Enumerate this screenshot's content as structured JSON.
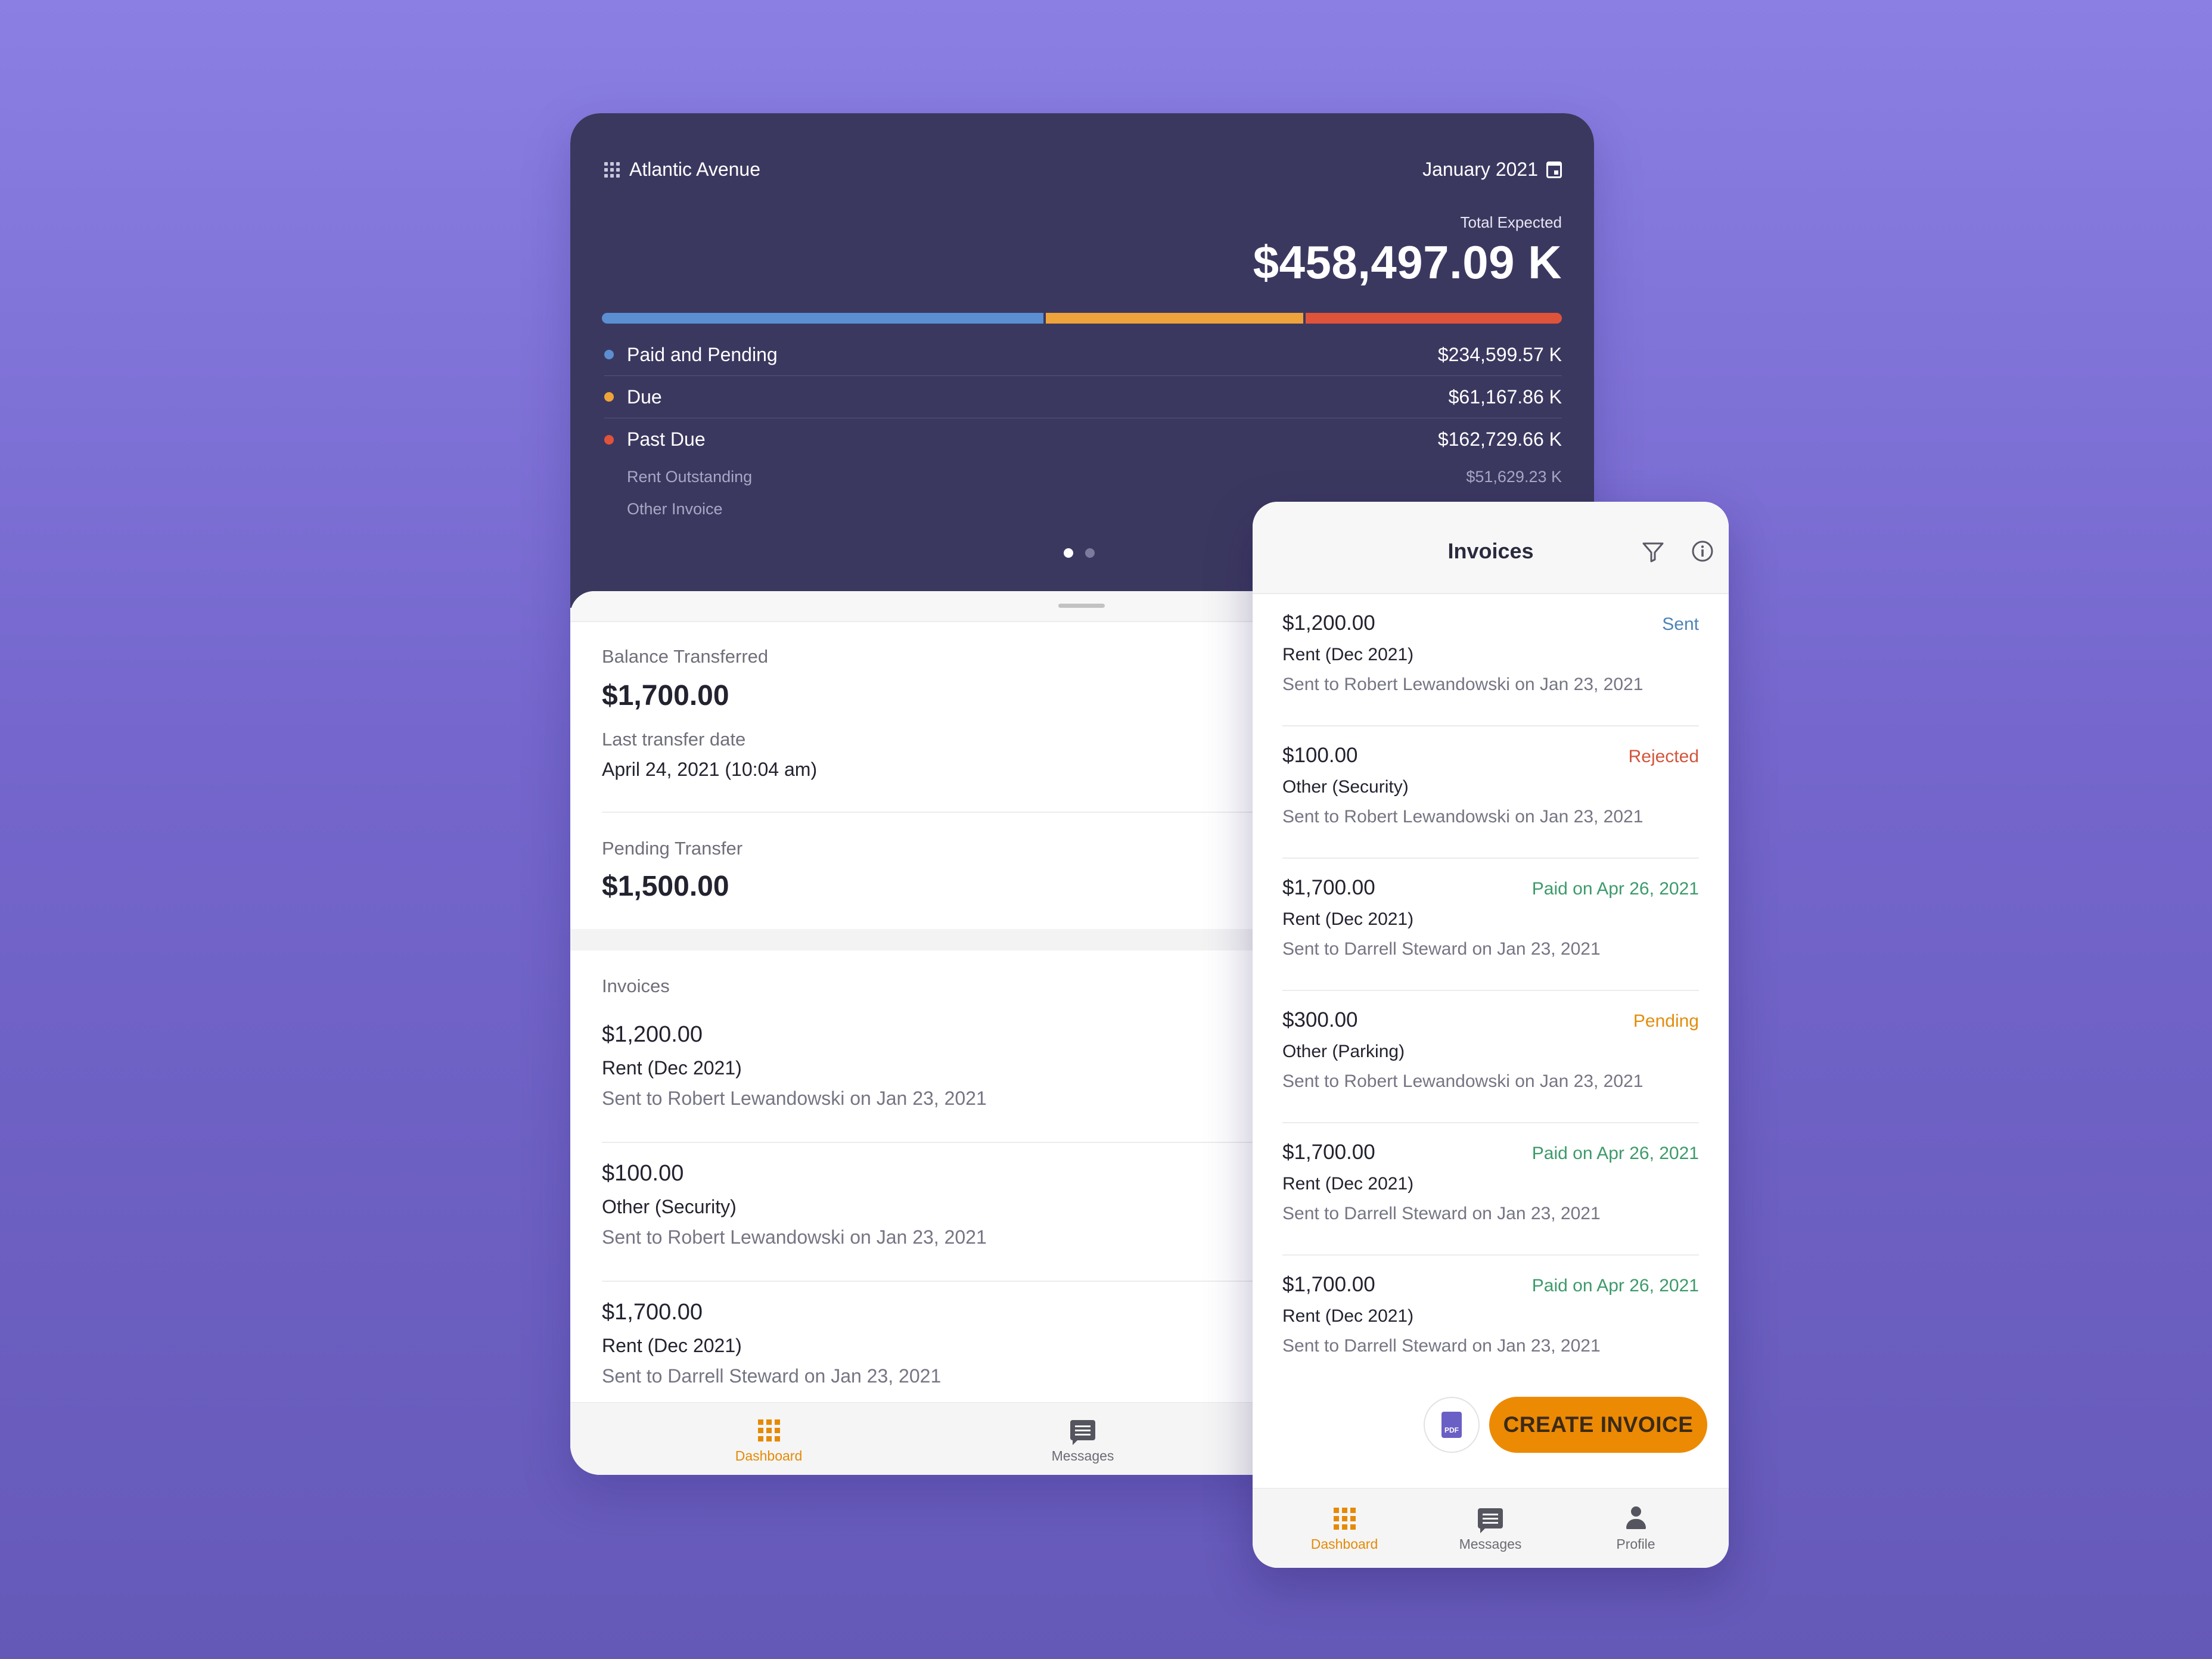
{
  "tablet": {
    "property": "Atlantic Avenue",
    "month": "January 2021",
    "total_label": "Total Expected",
    "total_value": "$458,497.09 K",
    "progress": [
      {
        "key": "paid",
        "fraction": 0.462,
        "color": "#5b8fd1"
      },
      {
        "key": "due",
        "fraction": 0.27,
        "color": "#eea43a"
      },
      {
        "key": "pastdue",
        "fraction": 0.268,
        "color": "#e0533b"
      }
    ],
    "summary": [
      {
        "label": "Paid and Pending",
        "value": "$234,599.57 K",
        "color": "#5b8fd1"
      },
      {
        "label": "Due",
        "value": "$61,167.86 K",
        "color": "#eea43a"
      },
      {
        "label": "Past Due",
        "value": "$162,729.66 K",
        "color": "#e0533b"
      }
    ],
    "sub_rows": [
      {
        "label": "Rent Outstanding",
        "value": "$51,629.23 K"
      },
      {
        "label": "Other Invoice",
        "value": ""
      }
    ],
    "balance_label": "Balance Transferred",
    "balance_value": "$1,700.00",
    "last_transfer_label": "Last transfer date",
    "last_transfer_value": "April 24, 2021 (10:04 am)",
    "pending_label": "Pending Transfer",
    "pending_value": "$1,500.00",
    "invoices_label": "Invoices",
    "invoices": [
      {
        "amount": "$1,200.00",
        "desc": "Rent (Dec 2021)",
        "sent": "Sent to Robert Lewandowski on Jan 23, 2021"
      },
      {
        "amount": "$100.00",
        "desc": "Other (Security)",
        "sent": "Sent to Robert Lewandowski on Jan 23, 2021"
      },
      {
        "amount": "$1,700.00",
        "desc": "Rent (Dec 2021)",
        "sent": "Sent to Darrell Steward on Jan 23, 2021"
      }
    ],
    "nav": {
      "dashboard": "Dashboard",
      "messages": "Messages"
    }
  },
  "phone": {
    "title": "Invoices",
    "invoices": [
      {
        "amount": "$1,200.00",
        "desc": "Rent (Dec 2021)",
        "sent": "Sent to Robert Lewandowski on Jan 23, 2021",
        "status": "Sent",
        "status_color": "#4f84b8"
      },
      {
        "amount": "$100.00",
        "desc": "Other (Security)",
        "sent": "Sent to Robert Lewandowski on Jan 23, 2021",
        "status": "Rejected",
        "status_color": "#d2563c"
      },
      {
        "amount": "$1,700.00",
        "desc": "Rent (Dec 2021)",
        "sent": "Sent to Darrell Steward on Jan 23, 2021",
        "status": "Paid on Apr 26, 2021",
        "status_color": "#3d9a6b"
      },
      {
        "amount": "$300.00",
        "desc": "Other (Parking)",
        "sent": "Sent to Robert Lewandowski on Jan 23, 2021",
        "status": "Pending",
        "status_color": "#e38d0d"
      },
      {
        "amount": "$1,700.00",
        "desc": "Rent (Dec 2021)",
        "sent": "Sent to Darrell Steward on Jan 23, 2021",
        "status": "Paid on Apr 26, 2021",
        "status_color": "#3d9a6b"
      },
      {
        "amount": "$1,700.00",
        "desc": "Rent (Dec 2021)",
        "sent": "Sent to Darrell Steward on Jan 23, 2021",
        "status": "Paid on Apr 26, 2021",
        "status_color": "#3d9a6b"
      }
    ],
    "pdf_label": "PDF",
    "create_label": "CREATE INVOICE",
    "nav": {
      "dashboard": "Dashboard",
      "messages": "Messages",
      "profile": "Profile"
    }
  },
  "colors": {
    "accent": "#e58a06",
    "dark_header": "#3b3860",
    "background": "#7b6fd6"
  },
  "icons": [
    "grid-icon",
    "calendar-icon",
    "filter-icon",
    "info-icon",
    "pdf-icon",
    "dashboard-icon",
    "messages-icon",
    "profile-icon"
  ]
}
